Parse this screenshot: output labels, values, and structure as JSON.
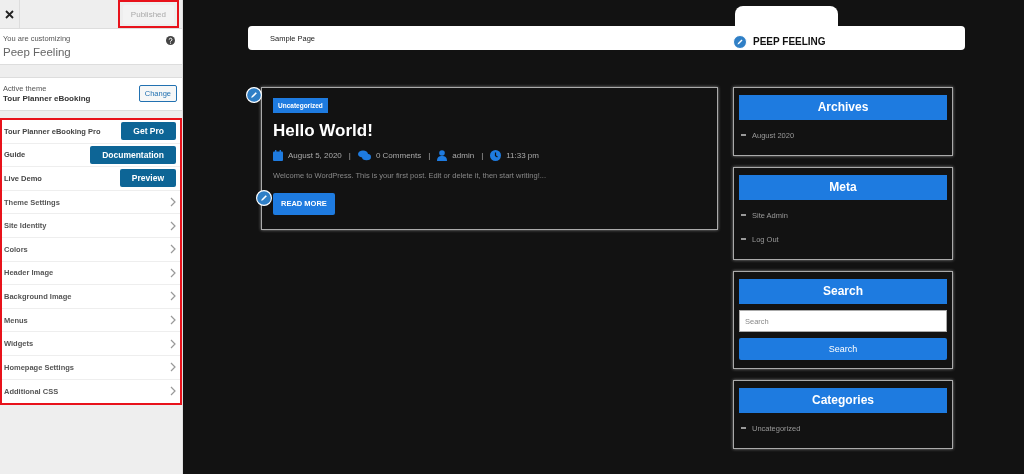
{
  "customizer": {
    "publish_button": {
      "label": "Published",
      "disabled": true
    },
    "info": {
      "caption": "You are customizing",
      "title": "Peep Feeling"
    },
    "theme": {
      "caption": "Active theme",
      "name": "Tour Planner eBooking",
      "button": "Change"
    },
    "items": [
      {
        "kind": "button",
        "label": "Tour Planner eBooking Pro",
        "button": "Get Pro"
      },
      {
        "kind": "button",
        "label": "Guide",
        "button": "Documentation"
      },
      {
        "kind": "button",
        "label": "Live Demo",
        "button": "Preview"
      },
      {
        "kind": "section",
        "label": "Theme Settings"
      },
      {
        "kind": "section",
        "label": "Site Identity"
      },
      {
        "kind": "section",
        "label": "Colors"
      },
      {
        "kind": "section",
        "label": "Header Image"
      },
      {
        "kind": "section",
        "label": "Background Image"
      },
      {
        "kind": "section",
        "label": "Menus"
      },
      {
        "kind": "section",
        "label": "Widgets"
      },
      {
        "kind": "section",
        "label": "Homepage Settings"
      },
      {
        "kind": "section",
        "label": "Additional CSS"
      }
    ]
  },
  "preview": {
    "nav": [
      "Sample Page"
    ],
    "site_title": "PEEP FEELING",
    "post": {
      "category": "Uncategorized",
      "title": "Hello World!",
      "date": "August 5, 2020",
      "comments": "0 Comments",
      "author": "admin",
      "time": "11:33 pm",
      "separator": "|",
      "excerpt": "Welcome to WordPress. This is your first post. Edit or delete it, then start writing!...",
      "button": "READ MORE"
    },
    "widgets": [
      {
        "kind": "list",
        "title": "Archives",
        "items": [
          "August 2020"
        ]
      },
      {
        "kind": "list",
        "title": "Meta",
        "items": [
          "Site Admin",
          "Log Out"
        ]
      },
      {
        "kind": "search",
        "title": "Search",
        "placeholder": "Search",
        "button": "Search"
      },
      {
        "kind": "list",
        "title": "Categories",
        "items": [
          "Uncategorized"
        ]
      }
    ]
  }
}
